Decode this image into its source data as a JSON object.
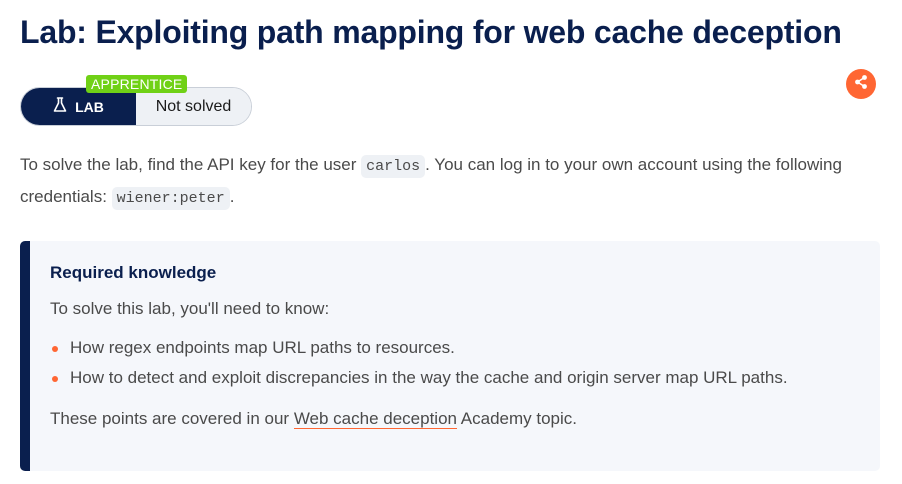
{
  "page": {
    "title": "Lab: Exploiting path mapping for web cache deception"
  },
  "lab_badge": {
    "level": "APPRENTICE",
    "type_label": "LAB",
    "type_icon": "flask-icon",
    "status": "Not solved"
  },
  "share": {
    "icon": "share-icon",
    "color": "#ff6633"
  },
  "intro": {
    "text_1": "To solve the lab, find the API key for the user ",
    "code_1": "carlos",
    "text_2": ". You can log in to your own account using the following credentials: ",
    "code_2": "wiener:peter",
    "text_3": "."
  },
  "knowledge": {
    "heading": "Required knowledge",
    "lead": "To solve this lab, you'll need to know:",
    "items": [
      "How regex endpoints map URL paths to resources.",
      "How to detect and exploit discrepancies in the way the cache and origin server map URL paths."
    ],
    "outro_before": "These points are covered in our ",
    "outro_link": "Web cache deception",
    "outro_after": " Academy topic."
  },
  "colors": {
    "navy": "#0a1f4e",
    "accent": "#ff6633",
    "apprentice_green": "#70d116",
    "panel_bg": "#f5f7fb"
  }
}
